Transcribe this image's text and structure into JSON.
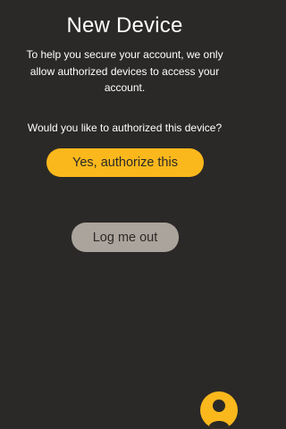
{
  "screen": {
    "title": "New Device",
    "intro": "To help you secure your account, we only allow authorized devices to access your account.",
    "question": "Would you like to authorized this device?"
  },
  "actions": {
    "authorize_label": "Yes, authorize this",
    "logout_label": "Log me out"
  },
  "fab": {
    "icon": "user-icon"
  },
  "colors": {
    "background": "#2b2927",
    "accent": "#fbb81c",
    "secondary_button": "#aba49c",
    "text": "#ffffff"
  }
}
